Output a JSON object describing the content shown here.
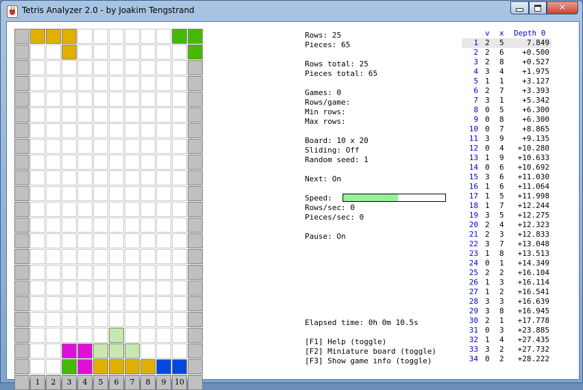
{
  "window": {
    "title": "Tetris Analyzer 2.0 - by Joakim Tengstrand",
    "close_glyph": "✕"
  },
  "colors": {
    "wall": "#c0c0c0",
    "yellow": "#e0b000",
    "green": "#44bb00",
    "lightgreen": "#c8e8b0",
    "magenta": "#e010d8",
    "blue": "#0048e0",
    "speed": "#98f098"
  },
  "board": {
    "columns": 10,
    "rows": 20,
    "wall_thickness": 1,
    "column_numbers": [
      "1",
      "2",
      "3",
      "4",
      "5",
      "6",
      "7",
      "8",
      "9",
      "10"
    ],
    "preview_cells": [
      {
        "r": 0,
        "c": 1,
        "color": "yellow"
      },
      {
        "r": 0,
        "c": 2,
        "color": "yellow"
      },
      {
        "r": 0,
        "c": 3,
        "color": "yellow"
      },
      {
        "r": 1,
        "c": 3,
        "color": "yellow"
      },
      {
        "r": 0,
        "c": 10,
        "color": "green"
      },
      {
        "r": 0,
        "c": 11,
        "color": "green"
      },
      {
        "r": 0,
        "c": 12,
        "color": "green"
      },
      {
        "r": 1,
        "c": 11,
        "color": "green"
      }
    ],
    "board_cells": [
      {
        "r": 17,
        "c": 6,
        "color": "lightgreen"
      },
      {
        "r": 18,
        "c": 5,
        "color": "lightgreen"
      },
      {
        "r": 18,
        "c": 6,
        "color": "lightgreen"
      },
      {
        "r": 18,
        "c": 7,
        "color": "lightgreen"
      },
      {
        "r": 18,
        "c": 3,
        "color": "magenta"
      },
      {
        "r": 18,
        "c": 4,
        "color": "magenta"
      },
      {
        "r": 19,
        "c": 3,
        "color": "green"
      },
      {
        "r": 19,
        "c": 4,
        "color": "magenta"
      },
      {
        "r": 19,
        "c": 5,
        "color": "yellow"
      },
      {
        "r": 19,
        "c": 6,
        "color": "yellow"
      },
      {
        "r": 19,
        "c": 7,
        "color": "yellow"
      },
      {
        "r": 19,
        "c": 8,
        "color": "yellow"
      },
      {
        "r": 19,
        "c": 9,
        "color": "blue"
      },
      {
        "r": 19,
        "c": 10,
        "color": "blue"
      }
    ]
  },
  "info": {
    "rows": "Rows: 25",
    "pieces": "Pieces: 65",
    "rows_total": "Rows total: 25",
    "pieces_total": "Pieces total: 65",
    "games": "Games: 0",
    "rows_per_game": "Rows/game:",
    "min_rows": "Min rows:",
    "max_rows": "Max rows:",
    "board_size": "Board: 10 x 20",
    "sliding": "Sliding: Off",
    "random_seed": "Random seed: 1",
    "next": "Next: On",
    "speed_label": "Speed:",
    "speed_level": 0.54,
    "rows_per_sec": "Rows/sec: 0",
    "pieces_per_sec": "Pieces/sec: 0",
    "pause": "Pause: On",
    "elapsed": "Elapsed time: 0h 0m 10.5s",
    "help_f1": "[F1] Help (toggle)",
    "help_f2": "[F2] Miniature board (toggle)",
    "help_f3": "[F3] Show game info (toggle)"
  },
  "moves": {
    "header": {
      "v": "v",
      "x": "x",
      "depth": "Depth 0"
    },
    "selected_index": 0,
    "rows": [
      {
        "i": "1",
        "v": "2",
        "x": "5",
        "d": "7.849"
      },
      {
        "i": "2",
        "v": "2",
        "x": "6",
        "d": "+0.500"
      },
      {
        "i": "3",
        "v": "2",
        "x": "8",
        "d": "+0.527"
      },
      {
        "i": "4",
        "v": "3",
        "x": "4",
        "d": "+1.975"
      },
      {
        "i": "5",
        "v": "1",
        "x": "1",
        "d": "+3.127"
      },
      {
        "i": "6",
        "v": "2",
        "x": "7",
        "d": "+3.393"
      },
      {
        "i": "7",
        "v": "3",
        "x": "1",
        "d": "+5.342"
      },
      {
        "i": "8",
        "v": "0",
        "x": "5",
        "d": "+6.300"
      },
      {
        "i": "9",
        "v": "0",
        "x": "8",
        "d": "+6.300"
      },
      {
        "i": "10",
        "v": "0",
        "x": "7",
        "d": "+8.865"
      },
      {
        "i": "11",
        "v": "3",
        "x": "9",
        "d": "+9.135"
      },
      {
        "i": "12",
        "v": "0",
        "x": "4",
        "d": "+10.280"
      },
      {
        "i": "13",
        "v": "1",
        "x": "9",
        "d": "+10.633"
      },
      {
        "i": "14",
        "v": "0",
        "x": "6",
        "d": "+10.692"
      },
      {
        "i": "15",
        "v": "3",
        "x": "6",
        "d": "+11.030"
      },
      {
        "i": "16",
        "v": "1",
        "x": "6",
        "d": "+11.064"
      },
      {
        "i": "17",
        "v": "1",
        "x": "5",
        "d": "+11.998"
      },
      {
        "i": "18",
        "v": "1",
        "x": "7",
        "d": "+12.244"
      },
      {
        "i": "19",
        "v": "3",
        "x": "5",
        "d": "+12.275"
      },
      {
        "i": "20",
        "v": "2",
        "x": "4",
        "d": "+12.323"
      },
      {
        "i": "21",
        "v": "2",
        "x": "3",
        "d": "+12.833"
      },
      {
        "i": "22",
        "v": "3",
        "x": "7",
        "d": "+13.048"
      },
      {
        "i": "23",
        "v": "1",
        "x": "8",
        "d": "+13.513"
      },
      {
        "i": "24",
        "v": "0",
        "x": "1",
        "d": "+14.349"
      },
      {
        "i": "25",
        "v": "2",
        "x": "2",
        "d": "+16.104"
      },
      {
        "i": "26",
        "v": "1",
        "x": "3",
        "d": "+16.114"
      },
      {
        "i": "27",
        "v": "1",
        "x": "2",
        "d": "+16.541"
      },
      {
        "i": "28",
        "v": "3",
        "x": "3",
        "d": "+16.639"
      },
      {
        "i": "29",
        "v": "3",
        "x": "8",
        "d": "+16.945"
      },
      {
        "i": "30",
        "v": "2",
        "x": "1",
        "d": "+17.778"
      },
      {
        "i": "31",
        "v": "0",
        "x": "3",
        "d": "+23.885"
      },
      {
        "i": "32",
        "v": "1",
        "x": "4",
        "d": "+27.435"
      },
      {
        "i": "33",
        "v": "3",
        "x": "2",
        "d": "+27.732"
      },
      {
        "i": "34",
        "v": "0",
        "x": "2",
        "d": "+28.222"
      }
    ]
  }
}
